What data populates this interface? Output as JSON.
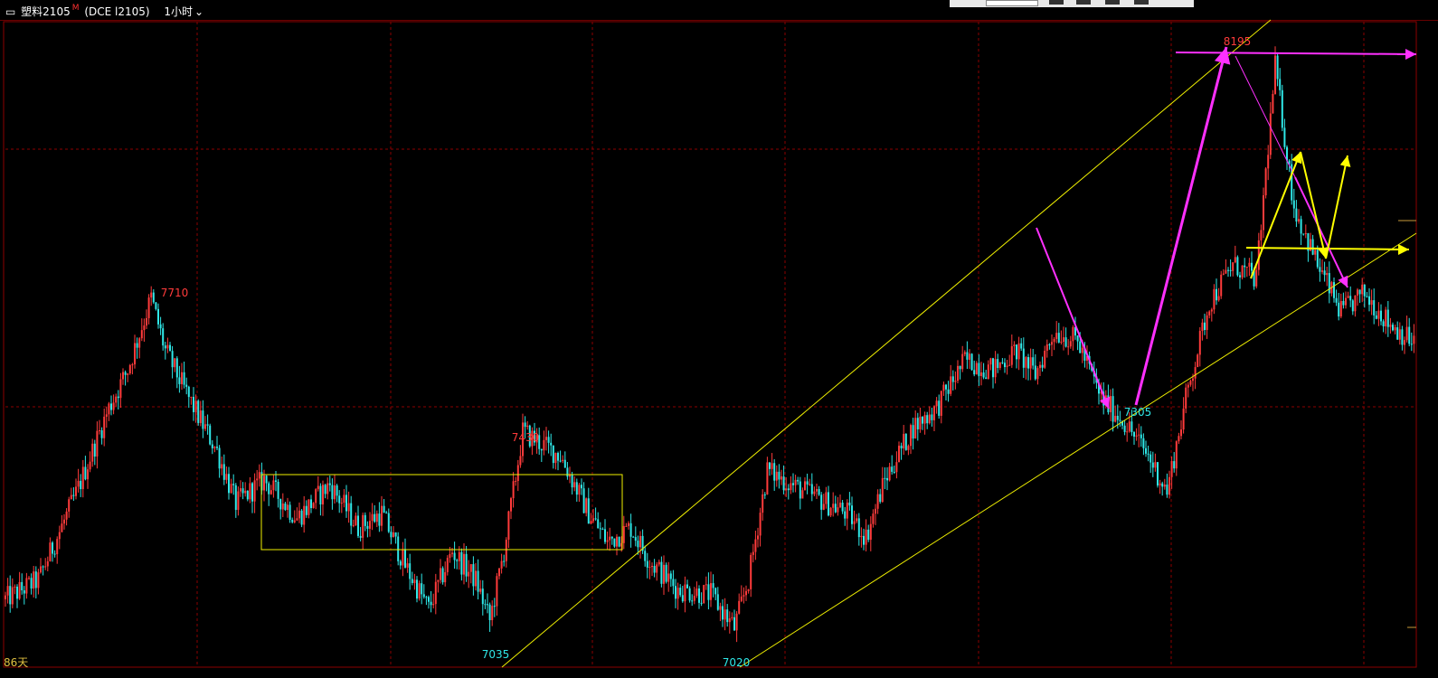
{
  "header": {
    "menu_icon": "window-menu-icon",
    "symbol": "塑料2105",
    "marker": "M",
    "contract": "(DCE l2105)",
    "period": "1小时",
    "period_icon": "chevron-down-icon"
  },
  "footer": {
    "days": "86天"
  },
  "colors": {
    "up": "#ff3b3b",
    "down": "#2fe8e8",
    "grid": "#8b0000",
    "channel": "#f0f000",
    "magenta": "#ff30ff",
    "yellow_arrow": "#ffff00"
  },
  "chart_data": {
    "type": "candlestick",
    "grid": true,
    "annotations": [
      {
        "text": "7710",
        "kind": "high"
      },
      {
        "text": "7430",
        "kind": "high"
      },
      {
        "text": "7035",
        "kind": "low"
      },
      {
        "text": "7020",
        "kind": "low"
      },
      {
        "text": "7305",
        "kind": "low"
      },
      {
        "text": "8195",
        "kind": "high"
      }
    ],
    "close_path": [
      [
        0,
        7080
      ],
      [
        14,
        7120
      ],
      [
        30,
        7300
      ],
      [
        44,
        7480
      ],
      [
        52,
        7560
      ],
      [
        62,
        7710
      ],
      [
        68,
        7600
      ],
      [
        78,
        7500
      ],
      [
        90,
        7390
      ],
      [
        98,
        7280
      ],
      [
        110,
        7330
      ],
      [
        124,
        7250
      ],
      [
        138,
        7320
      ],
      [
        150,
        7230
      ],
      [
        160,
        7260
      ],
      [
        170,
        7150
      ],
      [
        180,
        7060
      ],
      [
        190,
        7180
      ],
      [
        200,
        7120
      ],
      [
        206,
        7035
      ],
      [
        212,
        7180
      ],
      [
        220,
        7430
      ],
      [
        236,
        7380
      ],
      [
        248,
        7260
      ],
      [
        256,
        7200
      ],
      [
        266,
        7230
      ],
      [
        274,
        7160
      ],
      [
        286,
        7100
      ],
      [
        300,
        7090
      ],
      [
        310,
        7020
      ],
      [
        316,
        7120
      ],
      [
        324,
        7350
      ],
      [
        334,
        7320
      ],
      [
        346,
        7290
      ],
      [
        358,
        7260
      ],
      [
        366,
        7210
      ],
      [
        374,
        7330
      ],
      [
        386,
        7440
      ],
      [
        396,
        7480
      ],
      [
        408,
        7580
      ],
      [
        420,
        7560
      ],
      [
        430,
        7600
      ],
      [
        438,
        7550
      ],
      [
        446,
        7640
      ],
      [
        456,
        7620
      ],
      [
        466,
        7500
      ],
      [
        476,
        7450
      ],
      [
        486,
        7380
      ],
      [
        494,
        7305
      ],
      [
        502,
        7500
      ],
      [
        512,
        7700
      ],
      [
        522,
        7780
      ],
      [
        532,
        7750
      ],
      [
        540,
        8195
      ],
      [
        548,
        7900
      ],
      [
        558,
        7780
      ],
      [
        568,
        7680
      ],
      [
        578,
        7720
      ],
      [
        588,
        7660
      ],
      [
        598,
        7620
      ]
    ]
  }
}
